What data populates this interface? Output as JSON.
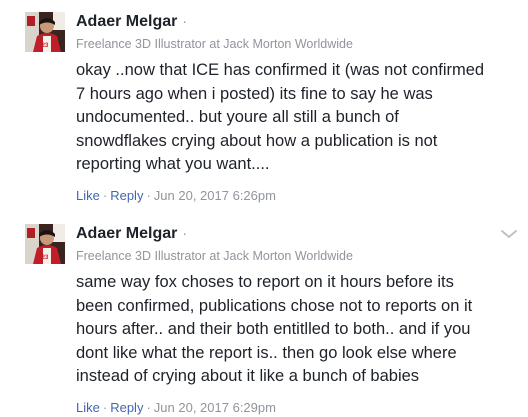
{
  "comments": [
    {
      "author": "Adaer Melgar",
      "author_dot": "·",
      "subtitle": "Freelance 3D Illustrator at Jack Morton Worldwide",
      "lines": [
        "okay ..now that ICE has confirmed it (was not confirmed",
        "7 hours ago when i posted) its fine to say he was",
        "undocumented.. but youre all still a bunch of",
        "snowdflakes crying about how a publication is not",
        "reporting what you want...."
      ],
      "like_label": "Like",
      "reply_label": "Reply",
      "separator": "·",
      "timestamp": "Jun 20, 2017 6:26pm",
      "avatar_icon": "profile-photo",
      "show_menu": false
    },
    {
      "author": "Adaer Melgar",
      "author_dot": "·",
      "subtitle": "Freelance 3D Illustrator at Jack Morton Worldwide",
      "lines": [
        "same way fox choses to report on it hours before its",
        "been confirmed, publications chose not to reports on it",
        "hours after.. and their both entitlled to both.. and if you",
        "dont like what the report is.. then go look else where",
        "instead of crying about it like a bunch of babies"
      ],
      "like_label": "Like",
      "reply_label": "Reply",
      "separator": "·",
      "timestamp": "Jun 20, 2017 6:29pm",
      "avatar_icon": "profile-photo",
      "menu_icon": "chevron-down-icon",
      "show_menu": true
    }
  ],
  "colors": {
    "text": "#1d2129",
    "muted": "#90949c",
    "link": "#4267b2"
  }
}
